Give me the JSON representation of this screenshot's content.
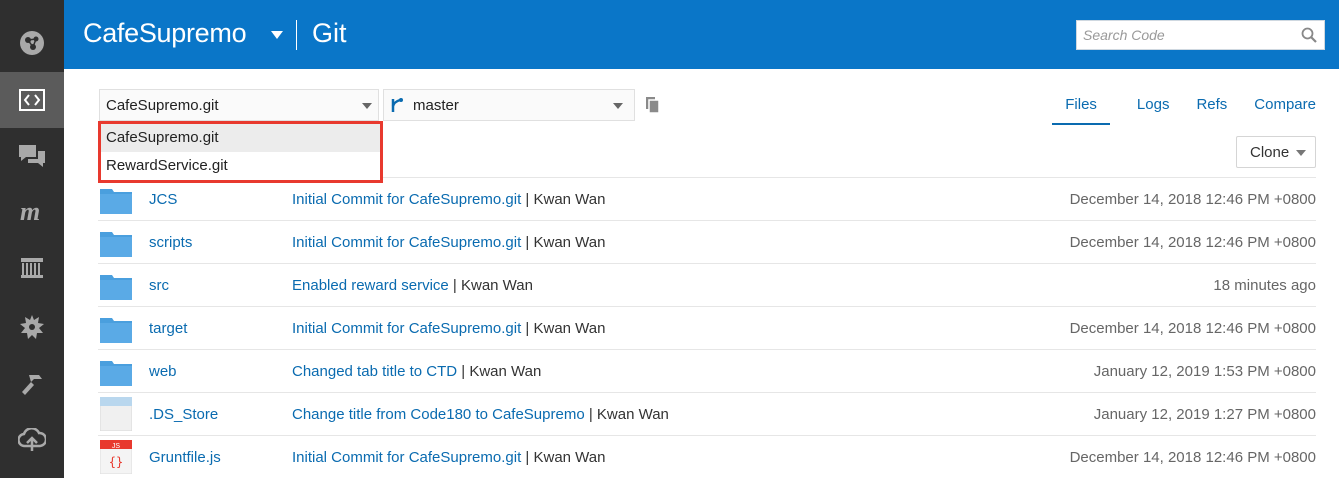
{
  "sidebar": {
    "items": [
      {
        "icon": "dashboard-icon"
      },
      {
        "icon": "code-icon",
        "active": true
      },
      {
        "icon": "chat-icon"
      },
      {
        "icon": "maven-icon"
      },
      {
        "icon": "repository-icon"
      },
      {
        "icon": "builds-icon"
      },
      {
        "icon": "hammer-icon"
      },
      {
        "icon": "cloud-upload-icon"
      }
    ]
  },
  "header": {
    "project": "CafeSupremo",
    "section": "Git",
    "search_placeholder": "Search Code",
    "background": "#0a76c8"
  },
  "toolbar": {
    "repo_selected": "CafeSupremo.git",
    "branch_selected": "master",
    "tabs": [
      "Files",
      "Logs",
      "Refs",
      "Compare"
    ],
    "active_tab": "Files",
    "clone_label": "Clone"
  },
  "repo_dropdown": {
    "options": [
      "CafeSupremo.git",
      "RewardService.git"
    ],
    "highlight_color": "#e8392e"
  },
  "files": [
    {
      "name": "JCS",
      "type": "folder",
      "message": "Initial Commit for CafeSupremo.git",
      "author": "Kwan Wan",
      "date": "December 14, 2018 12:46 PM +0800"
    },
    {
      "name": "scripts",
      "type": "folder",
      "message": "Initial Commit for CafeSupremo.git",
      "author": "Kwan Wan",
      "date": "December 14, 2018 12:46 PM +0800"
    },
    {
      "name": "src",
      "type": "folder",
      "message": "Enabled reward service",
      "author": "Kwan Wan",
      "date": "18 minutes ago"
    },
    {
      "name": "target",
      "type": "folder",
      "message": "Initial Commit for CafeSupremo.git",
      "author": "Kwan Wan",
      "date": "December 14, 2018 12:46 PM +0800"
    },
    {
      "name": "web",
      "type": "folder",
      "message": "Changed tab title to CTD",
      "author": "Kwan Wan",
      "date": "January 12, 2019 1:53 PM +0800"
    },
    {
      "name": ".DS_Store",
      "type": "file",
      "message": "Change title from Code180 to CafeSupremo",
      "author": "Kwan Wan",
      "date": "January 12, 2019 1:27 PM +0800"
    },
    {
      "name": "Gruntfile.js",
      "type": "js",
      "js_badge": "JS",
      "message": "Initial Commit for CafeSupremo.git",
      "author": "Kwan Wan",
      "date": "December 14, 2018 12:46 PM +0800"
    }
  ],
  "separator": "|"
}
